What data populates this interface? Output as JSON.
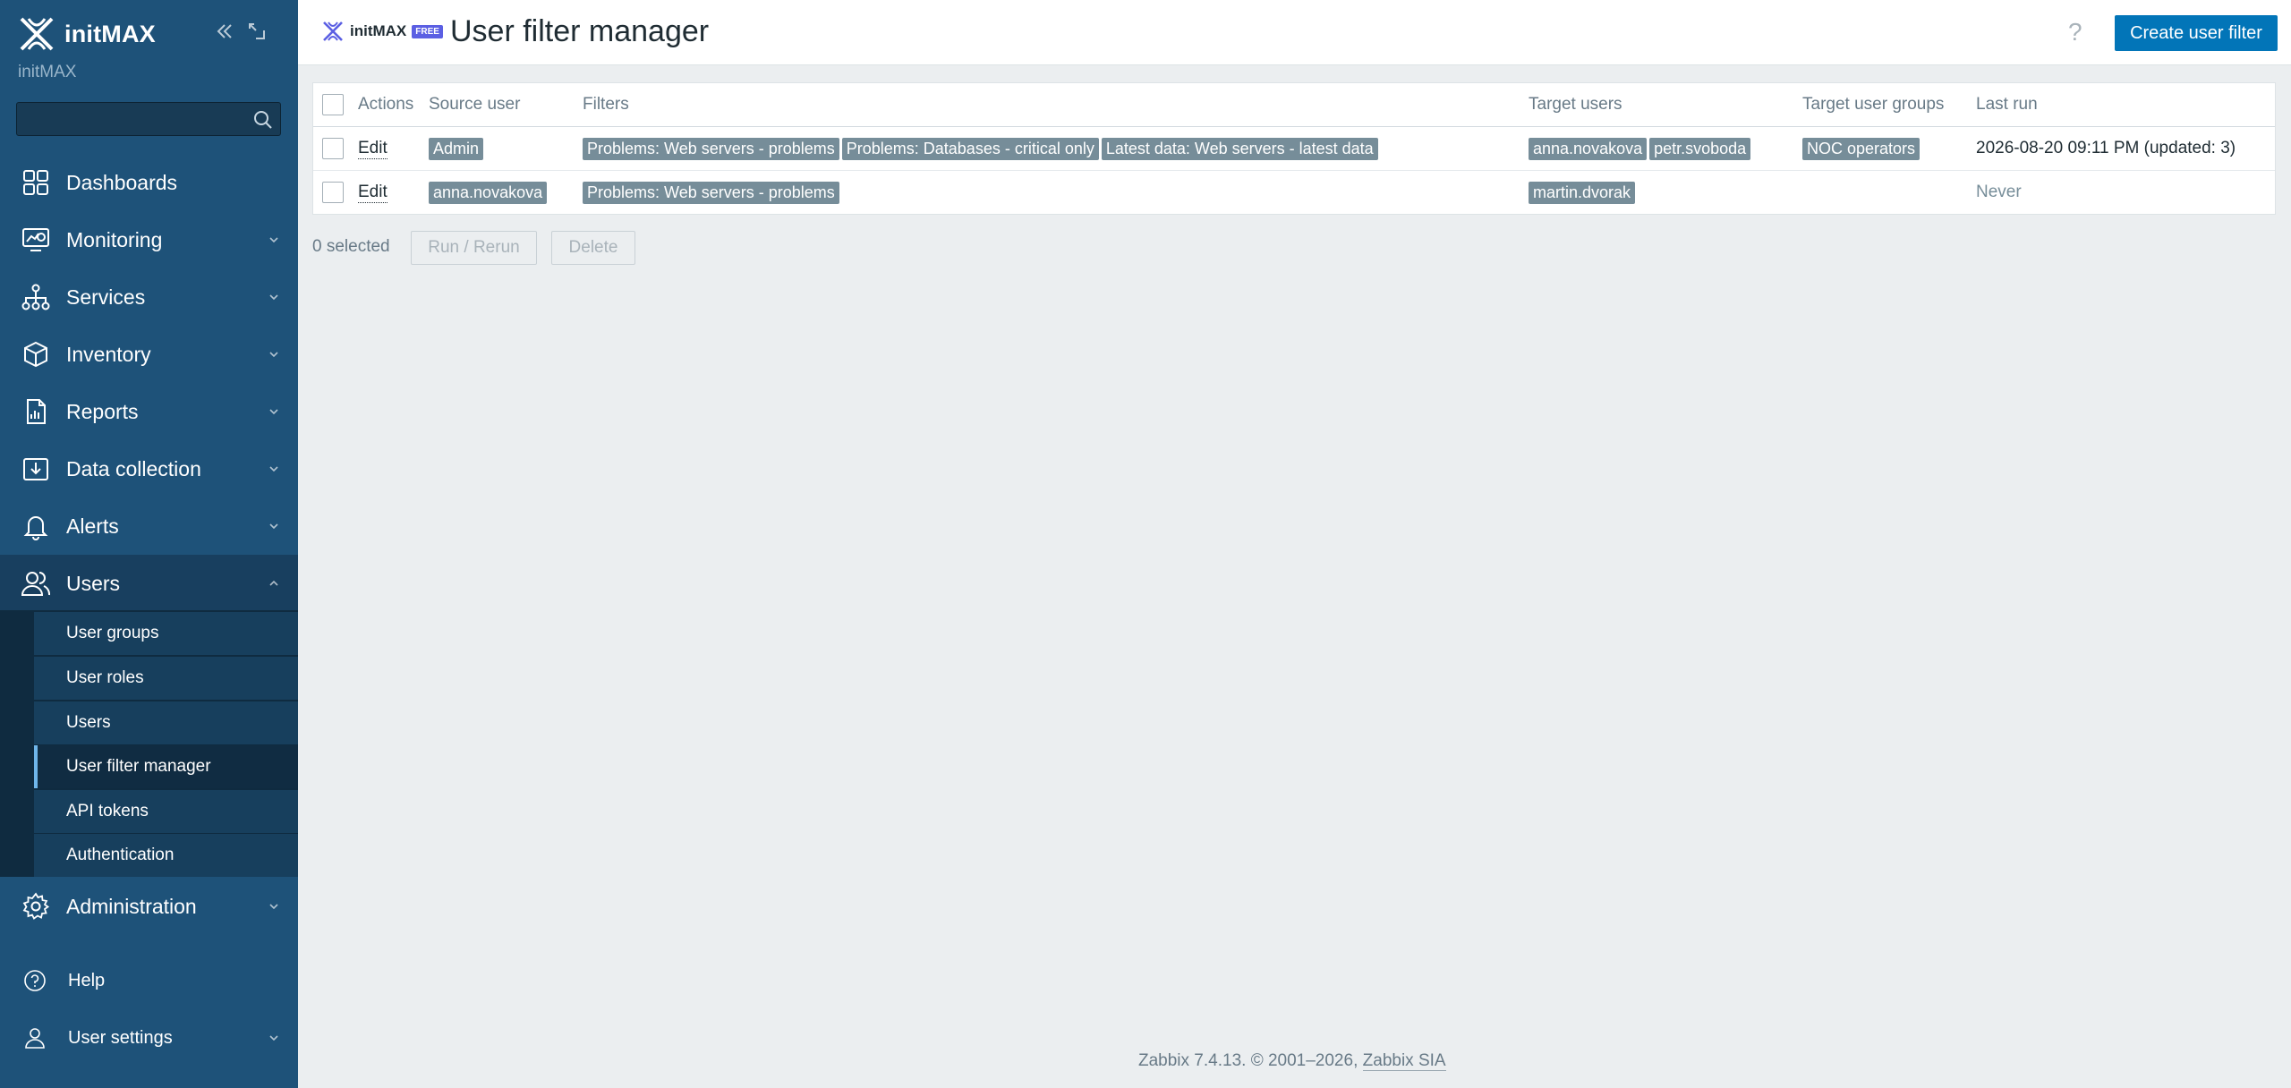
{
  "sidebar": {
    "brand": "initMAX",
    "subtitle": "initMAX",
    "search_placeholder": "",
    "nav": [
      {
        "label": "Dashboards",
        "icon": "dashboards-icon"
      },
      {
        "label": "Monitoring",
        "icon": "monitoring-icon"
      },
      {
        "label": "Services",
        "icon": "services-icon"
      },
      {
        "label": "Inventory",
        "icon": "inventory-icon"
      },
      {
        "label": "Reports",
        "icon": "reports-icon"
      },
      {
        "label": "Data collection",
        "icon": "data-collection-icon"
      },
      {
        "label": "Alerts",
        "icon": "alerts-icon"
      },
      {
        "label": "Users",
        "icon": "users-icon"
      }
    ],
    "users_submenu": [
      {
        "label": "User groups"
      },
      {
        "label": "User roles"
      },
      {
        "label": "Users"
      },
      {
        "label": "User filter manager"
      },
      {
        "label": "API tokens"
      },
      {
        "label": "Authentication"
      }
    ],
    "administration": "Administration",
    "help": "Help",
    "user_settings": "User settings"
  },
  "header": {
    "logo_text": "initMAX",
    "logo_badge": "FREE",
    "title": "User filter manager",
    "help": "?",
    "create_button": "Create user filter"
  },
  "table": {
    "columns": {
      "actions": "Actions",
      "source_user": "Source user",
      "filters": "Filters",
      "target_users": "Target users",
      "target_user_groups": "Target user groups",
      "last_run": "Last run"
    },
    "rows": [
      {
        "action": "Edit",
        "source_user": "Admin",
        "filters": [
          "Problems: Web servers - problems",
          "Problems: Databases - critical only",
          "Latest data: Web servers - latest data"
        ],
        "target_users": [
          "anna.novakova",
          "petr.svoboda"
        ],
        "target_user_groups": [
          "NOC operators"
        ],
        "last_run": "2026-08-20 09:11 PM (updated: 3)"
      },
      {
        "action": "Edit",
        "source_user": "anna.novakova",
        "filters": [
          "Problems: Web servers - problems"
        ],
        "target_users": [
          "martin.dvorak"
        ],
        "target_user_groups": [],
        "last_run": "Never"
      }
    ]
  },
  "footer_actions": {
    "selected": "0 selected",
    "run": "Run / Rerun",
    "delete": "Delete"
  },
  "copyright": {
    "text": "Zabbix 7.4.13. © 2001–2026, ",
    "link": "Zabbix SIA"
  },
  "colors": {
    "sidebar": "#1e5279",
    "accent": "#0275b8",
    "tag": "#768d99"
  }
}
